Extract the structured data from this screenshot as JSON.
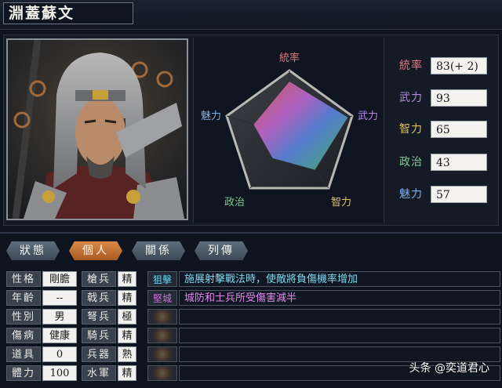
{
  "character": {
    "name": "淵蓋蘇文"
  },
  "radar": {
    "labels": {
      "top": "統率",
      "right": "武力",
      "bottom_right": "智力",
      "bottom_left": "政治",
      "left": "魅力"
    },
    "label_colors": {
      "top": "#e07a7a",
      "right": "#b48be0",
      "bottom_right": "#e0c060",
      "bottom_left": "#7ec98f",
      "left": "#7fb0e8"
    }
  },
  "stats": [
    {
      "label": "統率",
      "value": "83(+ 2)",
      "color": "#e07a7a"
    },
    {
      "label": "武力",
      "value": "93",
      "color": "#b48be0"
    },
    {
      "label": "智力",
      "value": "65",
      "color": "#e0c060"
    },
    {
      "label": "政治",
      "value": "43",
      "color": "#7ec98f"
    },
    {
      "label": "魅力",
      "value": "57",
      "color": "#7fb0e8"
    }
  ],
  "tabs": [
    "狀態",
    "個人",
    "關係",
    "列傳"
  ],
  "active_tab": "個人",
  "personal": [
    {
      "label": "性格",
      "value": "剛膽"
    },
    {
      "label": "年齡",
      "value": "--"
    },
    {
      "label": "性別",
      "value": "男"
    },
    {
      "label": "傷病",
      "value": "健康"
    },
    {
      "label": "道具",
      "value": "0"
    },
    {
      "label": "體力",
      "value": "100"
    }
  ],
  "troops": [
    {
      "label": "槍兵",
      "value": "精"
    },
    {
      "label": "戟兵",
      "value": "精"
    },
    {
      "label": "弩兵",
      "value": "極"
    },
    {
      "label": "騎兵",
      "value": "精"
    },
    {
      "label": "兵器",
      "value": "熟"
    },
    {
      "label": "水軍",
      "value": "精"
    }
  ],
  "skills": [
    {
      "name": "狙擊",
      "color": "#66d0e8",
      "desc": "施展射擊戰法時，使敵將負傷機率增加",
      "desc_color": "#7fd8ee"
    },
    {
      "name": "堅城",
      "color": "#d070d8",
      "desc": "城防和士兵所受傷害減半",
      "desc_color": "#e089e8"
    },
    {
      "name": "",
      "desc": ""
    },
    {
      "name": "",
      "desc": ""
    },
    {
      "name": "",
      "desc": ""
    },
    {
      "name": "",
      "desc": ""
    }
  ],
  "watermark": "头条 @奕道君心"
}
